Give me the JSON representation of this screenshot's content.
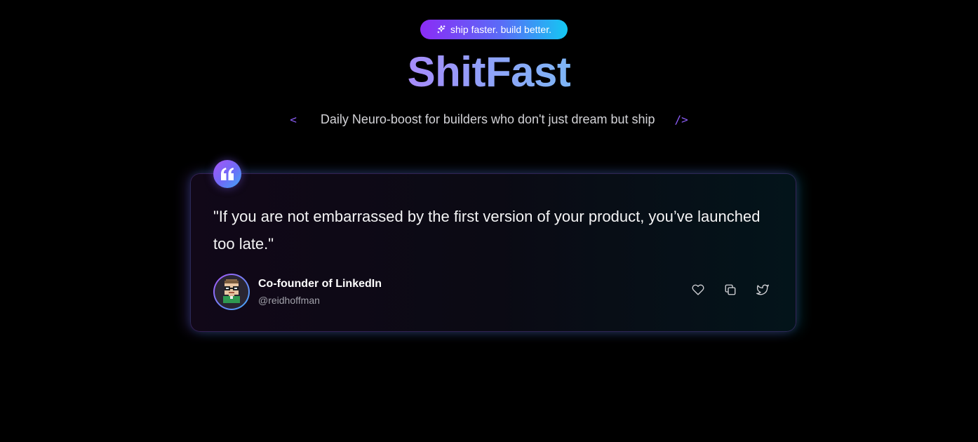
{
  "badge": {
    "icon": "sparkle-icon",
    "label": "ship faster. build better."
  },
  "brand": {
    "title": "ShitFast"
  },
  "tagline": {
    "open_bracket": "<",
    "text": "Daily Neuro-boost for builders who don't just dream but ship",
    "close_bracket": "/>"
  },
  "quote_card": {
    "quote_icon": "quote-mark-icon",
    "text": "\"If you are not embarrassed by the first version of your product, you’ve launched too late.\"",
    "author": {
      "name": "Co-founder of LinkedIn",
      "handle": "@reidhoffman",
      "avatar_icon": "pixel-avatar"
    },
    "actions": [
      {
        "name": "like",
        "icon": "heart-icon"
      },
      {
        "name": "copy",
        "icon": "copy-icon"
      },
      {
        "name": "tweet",
        "icon": "twitter-icon"
      }
    ]
  },
  "colors": {
    "background": "#000000",
    "accent_purple": "#8b5cf6",
    "accent_cyan": "#14c8f2"
  }
}
